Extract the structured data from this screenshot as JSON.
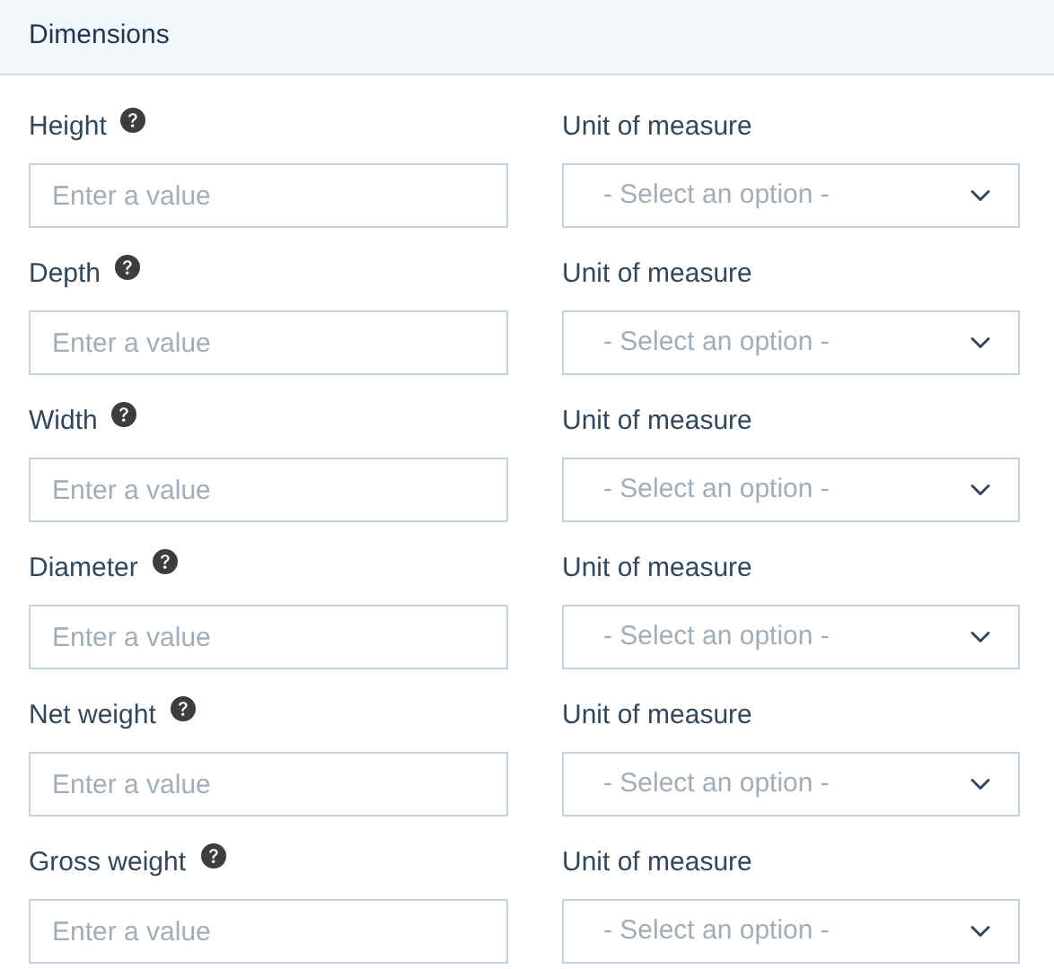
{
  "section": {
    "title": "Dimensions"
  },
  "rows": [
    {
      "label": "Height",
      "value_placeholder": "Enter a value",
      "unit_label": "Unit of measure",
      "unit_placeholder": "- Select an option -"
    },
    {
      "label": "Depth",
      "value_placeholder": "Enter a value",
      "unit_label": "Unit of measure",
      "unit_placeholder": "- Select an option -"
    },
    {
      "label": "Width",
      "value_placeholder": "Enter a value",
      "unit_label": "Unit of measure",
      "unit_placeholder": "- Select an option -"
    },
    {
      "label": "Diameter",
      "value_placeholder": "Enter a value",
      "unit_label": "Unit of measure",
      "unit_placeholder": "- Select an option -"
    },
    {
      "label": "Net weight",
      "value_placeholder": "Enter a value",
      "unit_label": "Unit of measure",
      "unit_placeholder": "- Select an option -"
    },
    {
      "label": "Gross weight",
      "value_placeholder": "Enter a value",
      "unit_label": "Unit of measure",
      "unit_placeholder": "- Select an option -"
    }
  ]
}
